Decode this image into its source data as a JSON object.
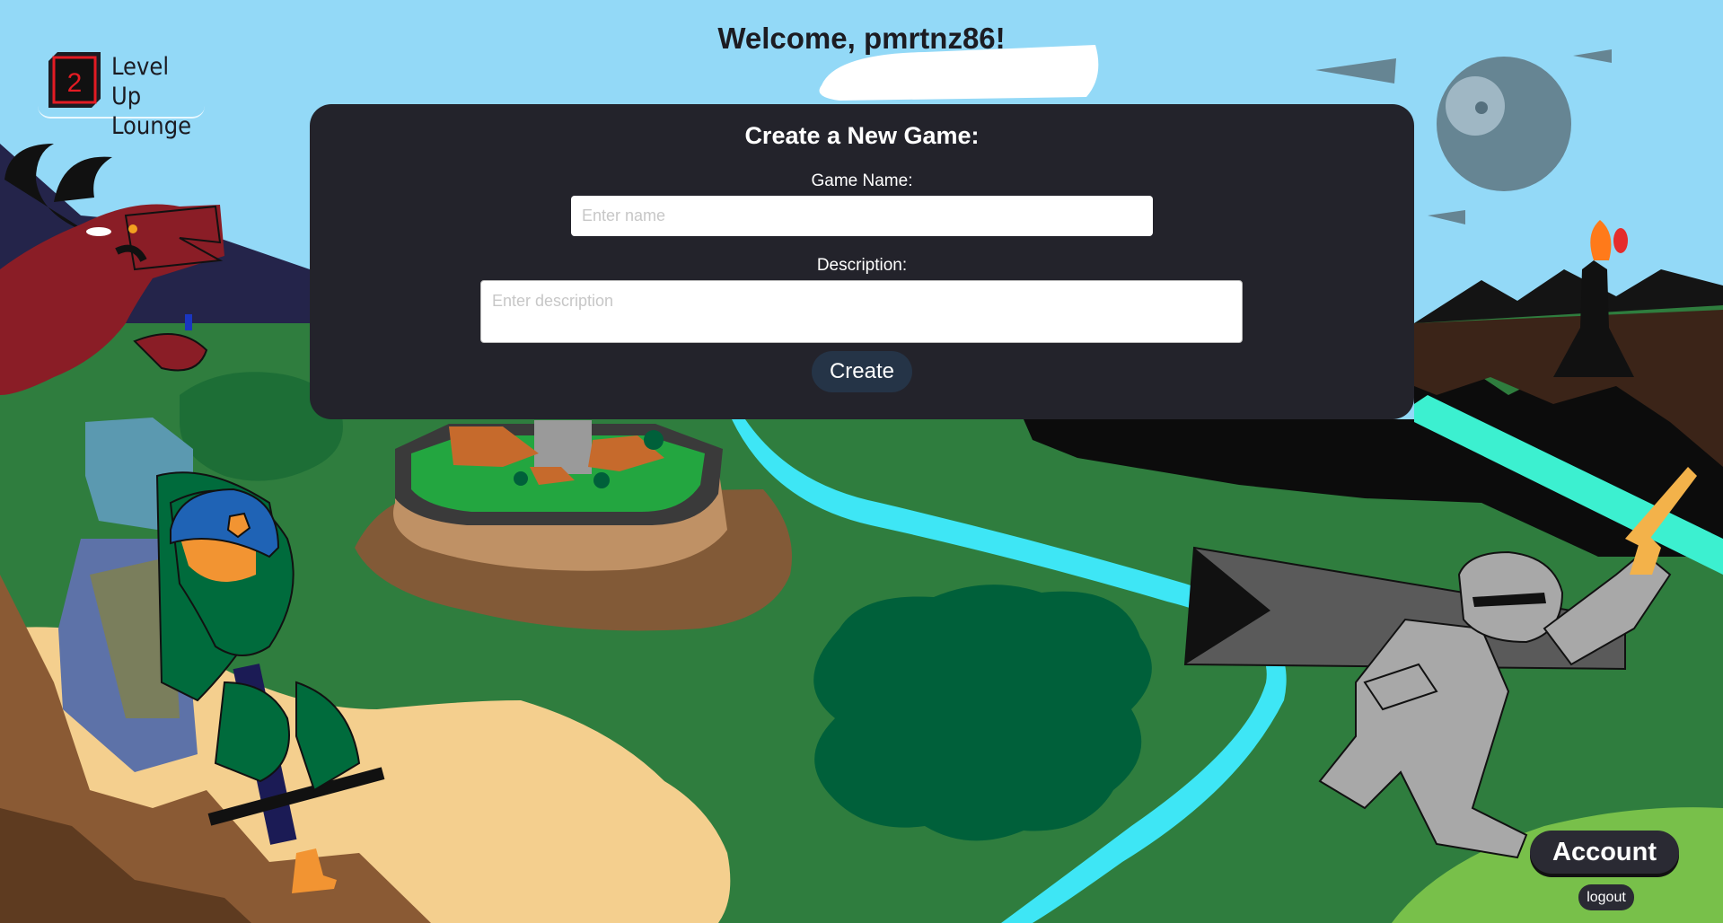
{
  "brand": {
    "logo_number": "2",
    "line1": "Level Up",
    "line2": "Lounge"
  },
  "header": {
    "welcome": "Welcome, pmrtnz86!"
  },
  "form": {
    "title": "Create a New Game:",
    "name_label": "Game Name:",
    "name_placeholder": "Enter name",
    "name_value": "",
    "description_label": "Description:",
    "description_placeholder": "Enter description",
    "description_value": "",
    "create_label": "Create"
  },
  "account": {
    "account_label": "Account",
    "logout_label": "logout"
  },
  "colors": {
    "sky": "#93d9f7",
    "panel": "#23232b",
    "grass": "#2f7d3e",
    "river": "#3ee6f5",
    "button": "#253447"
  }
}
